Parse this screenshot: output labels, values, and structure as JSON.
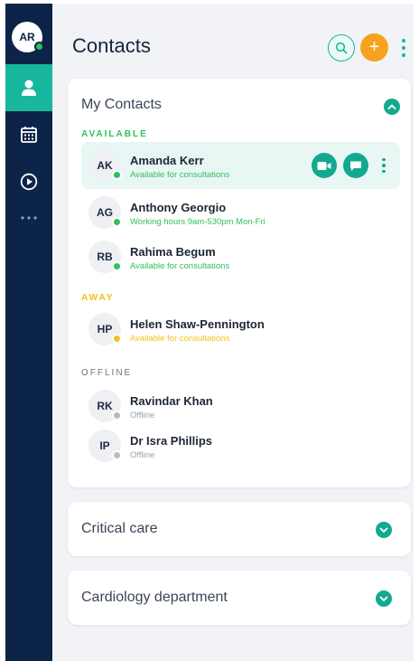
{
  "user": {
    "initials": "AR",
    "status_color": "#2fbf5b"
  },
  "header": {
    "title": "Contacts",
    "add_label": "+"
  },
  "colors": {
    "accent": "#17b79e",
    "sidebar": "#0c2447",
    "available": "#2fbf5b",
    "away": "#f2c11a",
    "offline": "#b8bdc4"
  },
  "my_contacts": {
    "title": "My Contacts",
    "sections": {
      "available": {
        "label": "AVAILABLE"
      },
      "away": {
        "label": "AWAY"
      },
      "offline": {
        "label": "OFFLINE"
      }
    },
    "contacts": [
      {
        "initials": "AK",
        "name": "Amanda Kerr",
        "status": "Available for consultations"
      },
      {
        "initials": "AG",
        "name": "Anthony Georgio",
        "status": "Working hours 9am-530pm Mon-Fri"
      },
      {
        "initials": "RB",
        "name": "Rahima Begum",
        "status": "Available for consultations"
      },
      {
        "initials": "HP",
        "name": "Helen Shaw-Pennington",
        "status": "Available for consultations"
      },
      {
        "initials": "RK",
        "name": "Ravindar Khan",
        "status": "Offline"
      },
      {
        "initials": "IP",
        "name": "Dr Isra Phillips",
        "status": "Offline"
      }
    ]
  },
  "groups": [
    {
      "title": "Critical care"
    },
    {
      "title": "Cardiology department"
    }
  ]
}
